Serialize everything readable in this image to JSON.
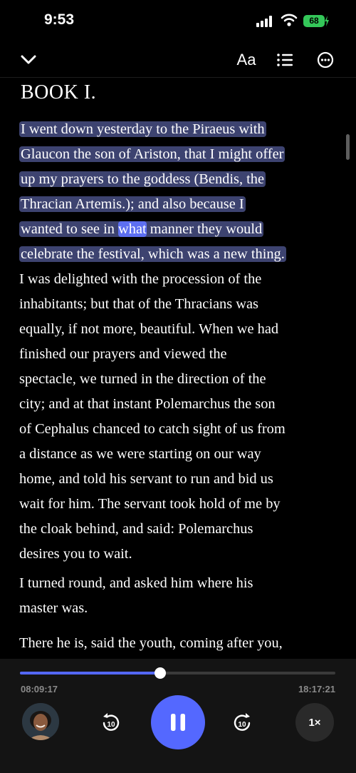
{
  "status_bar": {
    "time": "9:53",
    "battery": "68"
  },
  "toolbar": {
    "font_button_label": "Aa"
  },
  "book": {
    "heading": "BOOK I.",
    "highlighted_lines": [
      "I went down yesterday to the Piraeus with",
      "Glaucon the son of Ariston, that I might offer",
      "up my prayers to the goddess (Bendis, the",
      "Thracian Artemis.); and also because I"
    ],
    "highlight_line5_before": "wanted to see in ",
    "current_word": "what",
    "highlight_line5_after": " manner they would",
    "highlight_line6": "celebrate the festival, which was a new thing.",
    "paragraph1_rest_lines": [
      "I was delighted with the procession of the",
      "inhabitants; but that of the Thracians was",
      "equally, if not more, beautiful. When we had",
      "finished our prayers and viewed the",
      "spectacle, we turned in the direction of the",
      "city; and at that instant Polemarchus the son",
      "of Cephalus chanced to catch sight of us from",
      "a distance as we were starting on our way",
      "home, and told his servant to run and bid us",
      "wait for him. The servant took hold of me by",
      "the cloak behind, and said: Polemarchus",
      "desires you to wait."
    ],
    "paragraph2_lines": [
      "I turned round, and asked him where his",
      "master was."
    ],
    "paragraph3_lines": [
      "There he is, said the youth, coming after you,"
    ]
  },
  "player": {
    "elapsed": "08:09:17",
    "total": "18:17:21",
    "progress": 0.445,
    "skip_back_seconds": "10",
    "skip_forward_seconds": "10",
    "playback_rate": "1×",
    "accent_color": "#5468ff"
  },
  "colors": {
    "highlight": "#3d4370",
    "current_word": "#5d6ff2"
  }
}
